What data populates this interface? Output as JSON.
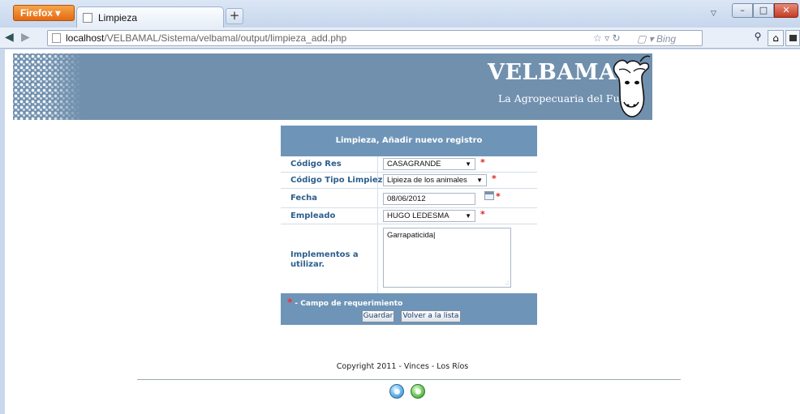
{
  "browser": {
    "app_button": "Firefox",
    "tab_title": "Limpieza",
    "new_tab": "+",
    "url_host": "localhost",
    "url_path": "/VELBAMAL/Sistema/velbamal/output/limpieza_add.php",
    "search_placeholder": "Bing"
  },
  "banner": {
    "title": "VELBAMAL",
    "subtitle": "La Agropecuaria del Futuro."
  },
  "form": {
    "header": "Limpieza, Añadir nuevo registro",
    "fields": {
      "codigo_res": {
        "label": "Código Res",
        "value": "CASAGRANDE"
      },
      "codigo_tipo": {
        "label": "Código Tipo Limpieza",
        "value": "Lipieza de los animales"
      },
      "fecha": {
        "label": "Fecha",
        "value": "08/06/2012"
      },
      "empleado": {
        "label": "Empleado",
        "value": "HUGO LEDESMA"
      },
      "implementos": {
        "label": "Implementos a utilizar.",
        "value": "Garrapaticida"
      }
    },
    "required_mark": "*",
    "required_note": " - Campo de requerimiento",
    "save_label": "Guardar",
    "back_label": "Volver a la lista"
  },
  "footer": {
    "copyright": "Copyright 2011 - Vinces - Los Ríos"
  },
  "colors": {
    "banner_bg": "#7090ae",
    "panel_accent": "#6e95b8",
    "label_text": "#2d5f8d",
    "required": "#e02020"
  }
}
